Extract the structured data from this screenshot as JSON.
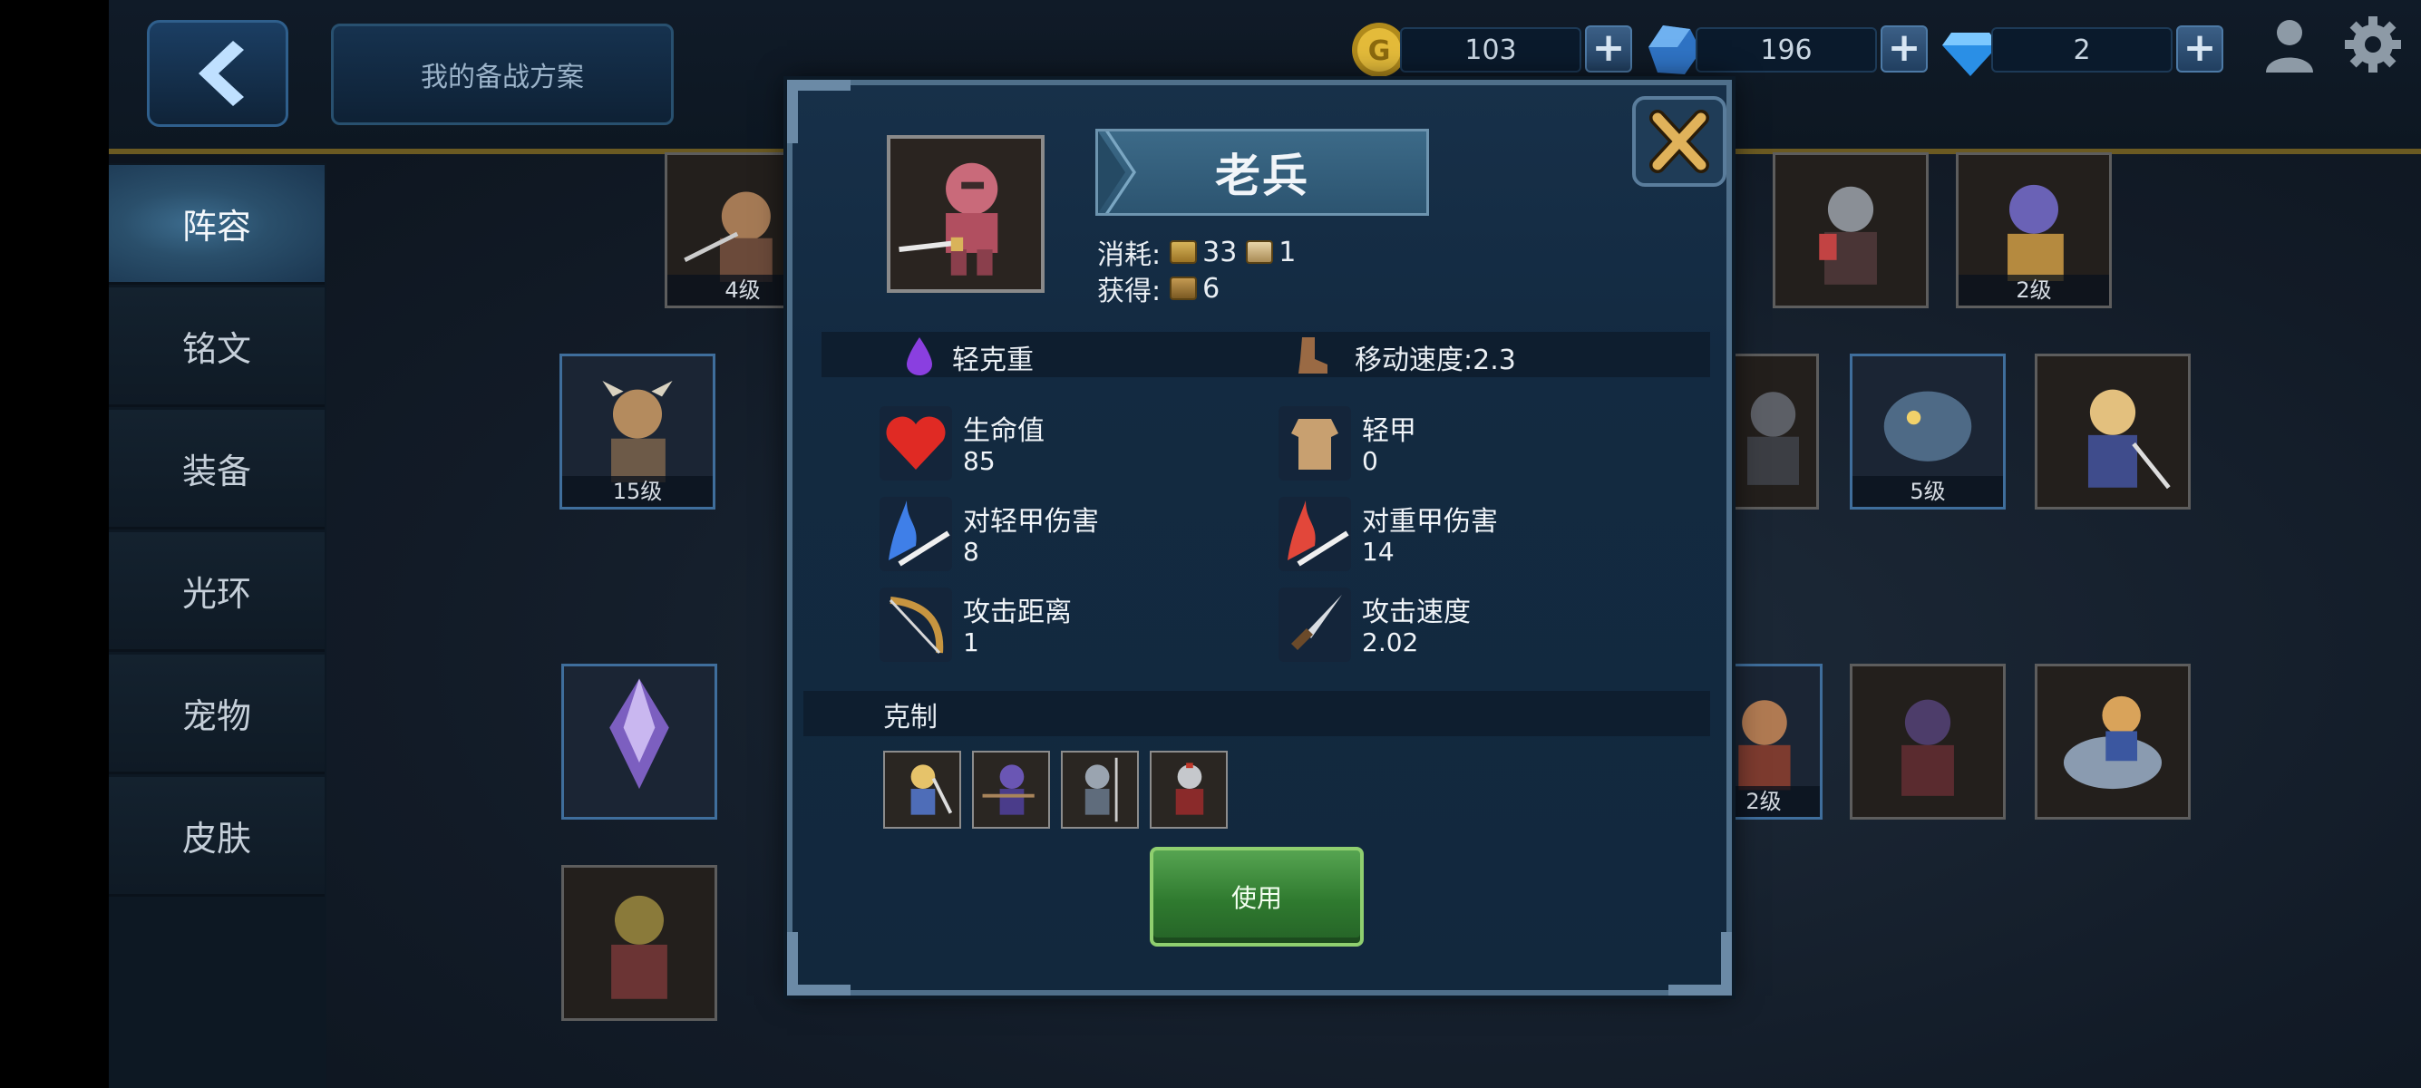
{
  "header": {
    "plan_button": "我的备战方案",
    "resources": [
      {
        "name": "gold",
        "value": "103"
      },
      {
        "name": "crystal",
        "value": "196"
      },
      {
        "name": "diamond",
        "value": "2"
      }
    ]
  },
  "sidebar": {
    "items": [
      {
        "label": "阵容",
        "active": true
      },
      {
        "label": "铭文",
        "active": false
      },
      {
        "label": "装备",
        "active": false
      },
      {
        "label": "光环",
        "active": false
      },
      {
        "label": "宠物",
        "active": false
      },
      {
        "label": "皮肤",
        "active": false
      }
    ]
  },
  "grid": {
    "levels": {
      "c1": "4级",
      "c2": "2级",
      "c3": "15级",
      "c4": "5级",
      "c5": "2级"
    }
  },
  "modal": {
    "unit_name": "老兵",
    "cost_label": "消耗:",
    "cost_gold": "33",
    "cost_pop": "1",
    "gain_label": "获得:",
    "gain_value": "6",
    "armor_class": "轻克重",
    "move_speed": "移动速度:2.3",
    "stats": [
      {
        "label": "生命值",
        "value": "85"
      },
      {
        "label": "轻甲",
        "value": "0"
      },
      {
        "label": "对轻甲伤害",
        "value": "8"
      },
      {
        "label": "对重甲伤害",
        "value": "14"
      },
      {
        "label": "攻击距离",
        "value": "1"
      },
      {
        "label": "攻击速度",
        "value": "2.02"
      }
    ],
    "counter_title": "克制",
    "use_button": "使用"
  },
  "colors": {
    "accent_gold": "#6b5a22",
    "modal_bg": "#132a41",
    "use_green": "#2f7a2f"
  }
}
